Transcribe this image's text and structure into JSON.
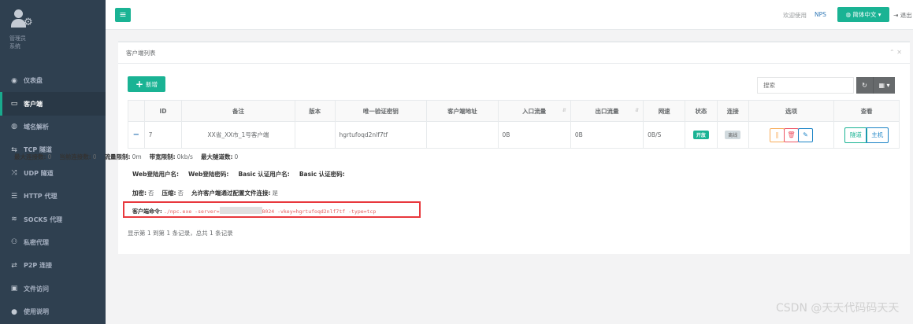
{
  "sidebar": {
    "profile_name": "管理员",
    "profile_sub": "系统",
    "items": [
      {
        "icon": "tachometer-icon",
        "glyph": "◉",
        "label": "仪表盘"
      },
      {
        "icon": "desktop-icon",
        "glyph": "▭",
        "label": "客户端"
      },
      {
        "icon": "globe-icon",
        "glyph": "◍",
        "label": "域名解析"
      },
      {
        "icon": "exchange-icon",
        "glyph": "⇆",
        "label": "TCP 隧道"
      },
      {
        "icon": "random-icon",
        "glyph": "⤨",
        "label": "UDP 隧道"
      },
      {
        "icon": "server-icon",
        "glyph": "☰",
        "label": "HTTP 代理"
      },
      {
        "icon": "database-icon",
        "glyph": "≋",
        "label": "SOCKS 代理"
      },
      {
        "icon": "handshake-icon",
        "glyph": "⚇",
        "label": "私密代理"
      },
      {
        "icon": "p2p-icon",
        "glyph": "⇄",
        "label": "P2P 连接"
      },
      {
        "icon": "briefcase-icon",
        "glyph": "▣",
        "label": "文件访问"
      },
      {
        "icon": "lightbulb-icon",
        "glyph": "●",
        "label": "使用说明"
      }
    ]
  },
  "topbar": {
    "menu_glyph": "≡",
    "welcome": "欢迎使用",
    "brand": "NPS",
    "language": "简体中文",
    "logout": "退出"
  },
  "panel": {
    "title": "客户端列表",
    "collapse_glyph": "⌃ ✕",
    "add_label": "新增",
    "search_placeholder": "搜索",
    "refresh_glyph": "↻",
    "columns_glyph": "▦ ▾"
  },
  "table": {
    "headers": [
      "ID",
      "备注",
      "版本",
      "唯一验证密钥",
      "客户端地址",
      "入口流量",
      "出口流量",
      "网速",
      "状态",
      "连接",
      "选项",
      "查看"
    ],
    "row": {
      "toggle": "−",
      "id": "7",
      "remark": "XX省_XX市_1号客户端",
      "version": "",
      "vkey": "hgrtufoqd2nlf7tf",
      "address": "",
      "in_flow": "0B",
      "out_flow": "0B",
      "speed": "0B/S",
      "status": "开放",
      "connection": "离线",
      "view_tunnel": "隧道",
      "view_host": "主机"
    }
  },
  "details": {
    "line1": [
      {
        "label": "最大连接数:",
        "value": "0"
      },
      {
        "label": "当前连接数:",
        "value": "0"
      },
      {
        "label": "流量限制:",
        "value": "0m"
      },
      {
        "label": "带宽限制:",
        "value": "0kb/s"
      },
      {
        "label": "最大隧道数:",
        "value": "0"
      }
    ],
    "line2": [
      {
        "label": "Web登陆用户名:",
        "value": ""
      },
      {
        "label": "Web登陆密码:",
        "value": ""
      },
      {
        "label": "Basic 认证用户名:",
        "value": ""
      },
      {
        "label": "Basic 认证密码:",
        "value": ""
      }
    ],
    "line3": [
      {
        "label": "加密:",
        "value": "否"
      },
      {
        "label": "压缩:",
        "value": "否"
      },
      {
        "label": "允许客户端通过配置文件连接:",
        "value": "是"
      }
    ],
    "command_label": "客户端命令:",
    "command_start": "./npc.exe -server=",
    "command_end": "8024 -vkey=hgrtufoqd2nlf7tf -type=tcp"
  },
  "footer": "显示第 1 到第 1 条记录，总共 1 条记录",
  "watermark": "CSDN @天天代码码天天",
  "colors": {
    "accent": "#1ab394",
    "sidebar": "#2f4050",
    "danger": "#ed5565",
    "warning": "#f8ac59",
    "info": "#1c84c6"
  }
}
